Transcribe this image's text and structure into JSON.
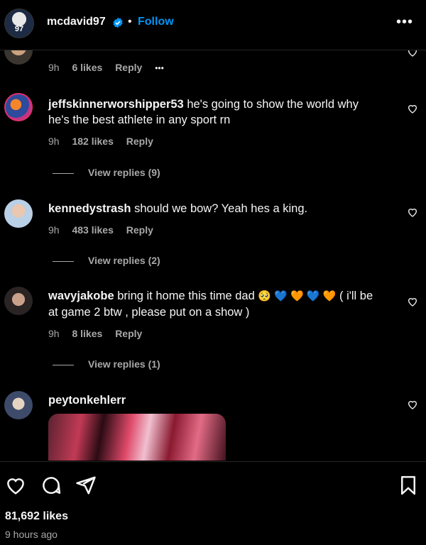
{
  "header": {
    "username": "mcdavid97",
    "separator": "•",
    "follow_label": "Follow",
    "avatar_text": "97",
    "more_label": "•••"
  },
  "comments": [
    {
      "username": "",
      "text": "",
      "time": "9h",
      "likes": "6 likes",
      "reply": "Reply",
      "more": "•••"
    },
    {
      "username": "jeffskinnerworshipper53",
      "text": "he's going to show the world why he's the best athlete in any sport rn",
      "time": "9h",
      "likes": "182 likes",
      "reply": "Reply",
      "view_replies": "View replies (9)"
    },
    {
      "username": "kennedystrash",
      "text": "should we bow? Yeah hes a king.",
      "time": "9h",
      "likes": "483 likes",
      "reply": "Reply",
      "view_replies": "View replies (2)"
    },
    {
      "username": "wavyjakobe",
      "text_before": "bring it home this time dad",
      "emojis": "🥺 💙 🧡 💙 🧡",
      "text_after": "( i'll be at game 2 btw , please put on a show )",
      "time": "9h",
      "likes": "8 likes",
      "reply": "Reply",
      "view_replies": "View replies (1)"
    },
    {
      "username": "peytonkehlerr"
    }
  ],
  "footer": {
    "likes_total": "81,692 likes",
    "time_ago": "9 hours ago"
  },
  "colors": {
    "accent": "#0095f6",
    "text": "#f5f5f5",
    "secondary": "#a8a8a8",
    "background": "#000000"
  },
  "icons": [
    "verified-badge-icon",
    "more-icon",
    "heart-icon",
    "comment-icon",
    "share-icon",
    "bookmark-icon"
  ]
}
